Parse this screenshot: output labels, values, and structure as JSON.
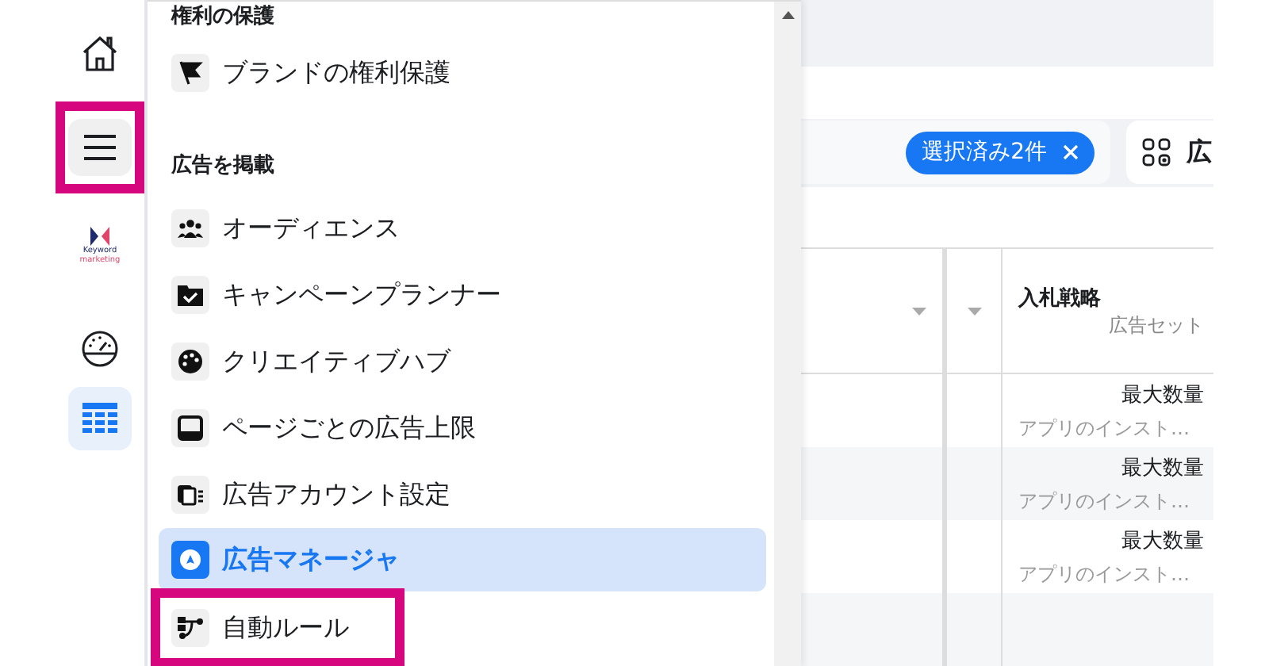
{
  "rail": {
    "items": [
      {
        "kind": "home",
        "selected": false,
        "highlighted": false
      },
      {
        "kind": "menu",
        "selected": false,
        "highlighted": true
      },
      {
        "kind": "logo",
        "selected": false,
        "highlighted": false,
        "logo_lines": [
          "Keyword",
          "marketing"
        ]
      },
      {
        "kind": "gauge",
        "selected": false,
        "highlighted": false
      },
      {
        "kind": "table",
        "selected": true,
        "highlighted": false
      }
    ]
  },
  "menu": {
    "sections": [
      {
        "title": "権利の保護",
        "items": [
          {
            "label": "ブランドの権利保護",
            "kind": "flag",
            "selected": false,
            "highlighted": false
          }
        ]
      },
      {
        "title": "広告を掲載",
        "items": [
          {
            "label": "オーディエンス",
            "kind": "people",
            "selected": false,
            "highlighted": false
          },
          {
            "label": "キャンペーンプランナー",
            "kind": "folder",
            "selected": false,
            "highlighted": false
          },
          {
            "label": "クリエイティブハブ",
            "kind": "palette",
            "selected": false,
            "highlighted": false
          },
          {
            "label": "ページごとの広告上限",
            "kind": "tablet",
            "selected": false,
            "highlighted": false
          },
          {
            "label": "広告アカウント設定",
            "kind": "cards",
            "selected": false,
            "highlighted": false
          },
          {
            "label": "広告マネージャ",
            "kind": "compass",
            "selected": true,
            "highlighted": false
          },
          {
            "label": "自動ルール",
            "kind": "flow",
            "selected": false,
            "highlighted": true
          }
        ]
      }
    ]
  },
  "toolbar": {
    "chip": "選択済み2件",
    "tab": "広"
  },
  "table": {
    "column": {
      "title": "入札戦略",
      "subtitle": "広告セット"
    },
    "rows": [
      {
        "value": "最大数量",
        "detail": "アプリのインスト…"
      },
      {
        "value": "最大数量",
        "detail": "アプリのインスト…"
      },
      {
        "value": "最大数量",
        "detail": "アプリのインスト…"
      }
    ]
  }
}
